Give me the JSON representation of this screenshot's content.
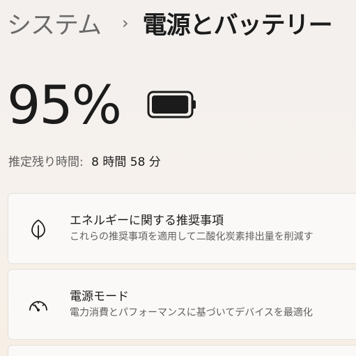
{
  "breadcrumb": {
    "parent": "システム",
    "separator": "›",
    "current": "電源とバッテリー"
  },
  "battery": {
    "percent_text": "95%",
    "level": 0.95,
    "icon": "battery-icon",
    "remaining_label": "推定残り時間:",
    "remaining_value": "8 時間 58 分"
  },
  "cards": [
    {
      "icon": "leaf-icon",
      "title": "エネルギーに関する推奨事項",
      "description": "これらの推奨事項を適用して二酸化炭素排出量を削減す"
    },
    {
      "icon": "gauge-icon",
      "title": "電源モード",
      "description": "電力消費とパフォーマンスに基づいてデバイスを最適化"
    }
  ]
}
